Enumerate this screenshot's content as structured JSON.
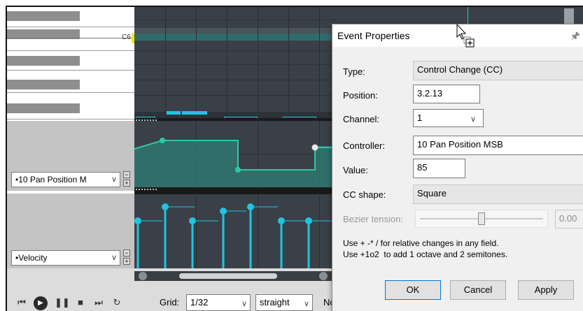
{
  "piano": {
    "c6_label": "C6"
  },
  "lanes": {
    "cc_lane_select": "•10 Pan Position M",
    "velocity_lane_select": "•Velocity"
  },
  "transport": {
    "grid_label": "Grid:",
    "grid_value": "1/32",
    "grid_mode": "straight",
    "notes_label_partial": "No"
  },
  "dialog": {
    "title": "Event Properties",
    "fields": {
      "type": {
        "label": "Type:",
        "value": "Control Change (CC)"
      },
      "position": {
        "label": "Position:",
        "value": "3.2.13"
      },
      "channel": {
        "label": "Channel:",
        "value": "1"
      },
      "controller": {
        "label": "Controller:",
        "value": "10 Pan Position MSB"
      },
      "value": {
        "label": "Value:",
        "value": "85"
      },
      "cc_shape": {
        "label": "CC shape:",
        "value": "Square"
      },
      "bezier_tension": {
        "label": "Bezier tension:",
        "value": "0.00",
        "level": 0.5
      }
    },
    "help_line1": "Use + -* / for relative changes in any field.",
    "help_line2": "Use +1o2  to add 1 octave and 2 semitones.",
    "buttons": {
      "ok": "OK",
      "cancel": "Cancel",
      "apply": "Apply"
    }
  },
  "colors": {
    "note": "#1fc4e0",
    "cc": "#2ec9a4",
    "grid_bg": "#3a4047",
    "accent_yellow": "#f5e400"
  },
  "icons": [
    "skip-back-icon",
    "play-icon",
    "pause-icon",
    "stop-icon",
    "skip-forward-icon",
    "loop-icon",
    "pin-icon",
    "mouse-cursor-icon"
  ]
}
